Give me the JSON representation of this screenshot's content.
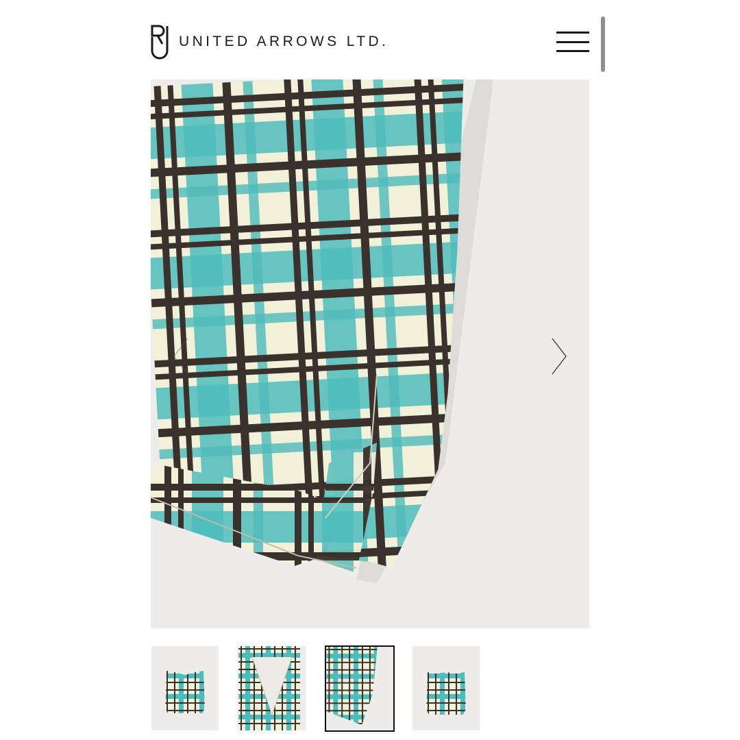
{
  "header": {
    "brand_name": "UNITED ARROWS LTD.",
    "logo_icon": "ua-monogram-logo",
    "menu_icon": "hamburger-menu-icon"
  },
  "gallery": {
    "prev_icon": "chevron-left-icon",
    "next_icon": "chevron-right-icon",
    "selected_index": 2,
    "image_count": 4,
    "thumbnails": [
      {
        "subject": "vest front view"
      },
      {
        "subject": "vest neckline close-up"
      },
      {
        "subject": "vest hem close-up"
      },
      {
        "subject": "vest back view"
      }
    ]
  },
  "colors": {
    "fabric_cream": "#f1f0d9",
    "check_teal": "#4fbcbc",
    "check_brown": "#3a302c",
    "photo_background": "#edecea",
    "text": "#1a1a1a"
  }
}
